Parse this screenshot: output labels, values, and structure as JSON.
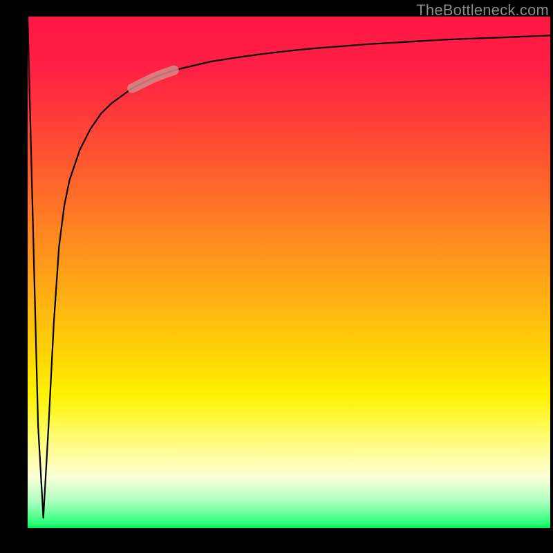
{
  "attribution": "TheBottleneck.com",
  "chart_data": {
    "type": "line",
    "title": "",
    "xlabel": "",
    "ylabel": "",
    "xlim": [
      0,
      100
    ],
    "ylim": [
      0,
      100
    ],
    "grid": false,
    "legend": false,
    "series": [
      {
        "name": "curve",
        "x": [
          0,
          1,
          2,
          3,
          4,
          5,
          6,
          7,
          8,
          10,
          12,
          14,
          16,
          18,
          20,
          22,
          24,
          26,
          28,
          30,
          35,
          40,
          45,
          50,
          55,
          60,
          65,
          70,
          75,
          80,
          85,
          90,
          95,
          100
        ],
        "y": [
          100,
          60,
          20,
          2,
          20,
          40,
          55,
          63,
          68,
          74,
          78,
          81,
          83,
          84.5,
          86,
          87,
          88,
          88.8,
          89.5,
          90,
          91.2,
          92,
          92.7,
          93.3,
          93.8,
          94.2,
          94.6,
          94.9,
          95.2,
          95.5,
          95.7,
          95.9,
          96.1,
          96.3
        ]
      }
    ],
    "highlight": {
      "series": "curve",
      "x_range": [
        20,
        28
      ],
      "color": "#d68a86"
    },
    "background_gradient": {
      "direction": "vertical",
      "stops": [
        {
          "pos": 0.0,
          "color": "#ff1744"
        },
        {
          "pos": 0.22,
          "color": "#ff4336"
        },
        {
          "pos": 0.45,
          "color": "#ff8f1e"
        },
        {
          "pos": 0.66,
          "color": "#ffd506"
        },
        {
          "pos": 0.82,
          "color": "#fffc6e"
        },
        {
          "pos": 0.95,
          "color": "#a8ffbe"
        },
        {
          "pos": 1.0,
          "color": "#07e85a"
        }
      ]
    }
  }
}
